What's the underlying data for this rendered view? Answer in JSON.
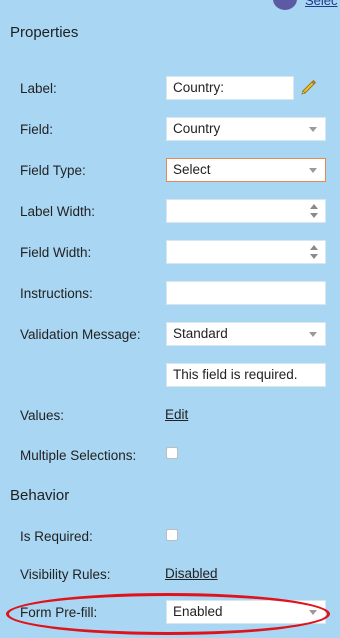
{
  "header": {
    "top_link_fragment": "Selec"
  },
  "properties": {
    "title": "Properties",
    "label": {
      "label": "Label:",
      "value": "Country:"
    },
    "field": {
      "label": "Field:",
      "value": "Country"
    },
    "field_type": {
      "label": "Field Type:",
      "value": "Select"
    },
    "label_width": {
      "label": "Label Width:",
      "value": ""
    },
    "field_width": {
      "label": "Field Width:",
      "value": ""
    },
    "instructions": {
      "label": "Instructions:",
      "value": ""
    },
    "validation_message": {
      "label": "Validation Message:",
      "value": "Standard",
      "text": "This field is required."
    },
    "values": {
      "label": "Values:",
      "link": "Edit"
    },
    "multiple_selections": {
      "label": "Multiple Selections:",
      "checked": false
    }
  },
  "behavior": {
    "title": "Behavior",
    "is_required": {
      "label": "Is Required:",
      "checked": false
    },
    "visibility_rules": {
      "label": "Visibility Rules:",
      "link": "Disabled"
    },
    "form_prefill": {
      "label": "Form Pre-fill:",
      "value": "Enabled"
    }
  },
  "colors": {
    "panel_bg": "#a9d6f2",
    "focus_border": "#e58a52",
    "annotation": "#e0121b"
  },
  "icons": {
    "edit": "pencil-icon",
    "avatar": "avatar-icon"
  }
}
